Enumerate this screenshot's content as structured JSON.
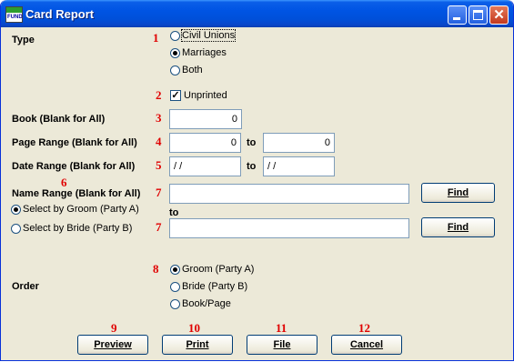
{
  "window": {
    "title": "Card Report",
    "icon": "fund-app-icon"
  },
  "type_section": {
    "label": "Type",
    "marker": "1",
    "options": [
      {
        "label": "Civil Unions",
        "selected": false
      },
      {
        "label": "Marriages",
        "selected": true
      },
      {
        "label": "Both",
        "selected": false
      }
    ]
  },
  "unprinted": {
    "marker": "2",
    "label": "Unprinted",
    "checked": true
  },
  "book": {
    "label": "Book (Blank for All)",
    "marker": "3",
    "value": "0"
  },
  "page_range": {
    "label": "Page Range (Blank for All)",
    "marker": "4",
    "from": "0",
    "to_label": "to",
    "to": "0"
  },
  "date_range": {
    "label": "Date Range (Blank for All)",
    "marker": "5",
    "from": "/ /",
    "to_label": "to",
    "to": "/ /"
  },
  "name_range": {
    "label": "Name Range (Blank for All)",
    "label_marker": "6",
    "from_marker": "7",
    "to_marker": "7",
    "from": "",
    "to_label": "to",
    "to": "",
    "find_label": "Find",
    "options": [
      {
        "label": "Select by Groom (Party A)",
        "selected": true
      },
      {
        "label": "Select by Bride (Party B)",
        "selected": false
      }
    ]
  },
  "order": {
    "label": "Order",
    "marker": "8",
    "options": [
      {
        "label": "Groom (Party A)",
        "selected": true
      },
      {
        "label": "Bride (Party B)",
        "selected": false
      },
      {
        "label": "Book/Page",
        "selected": false
      }
    ]
  },
  "buttons": [
    {
      "label": "Preview",
      "marker": "9"
    },
    {
      "label": "Print",
      "marker": "10"
    },
    {
      "label": "File",
      "marker": "11"
    },
    {
      "label": "Cancel",
      "marker": "12"
    }
  ]
}
